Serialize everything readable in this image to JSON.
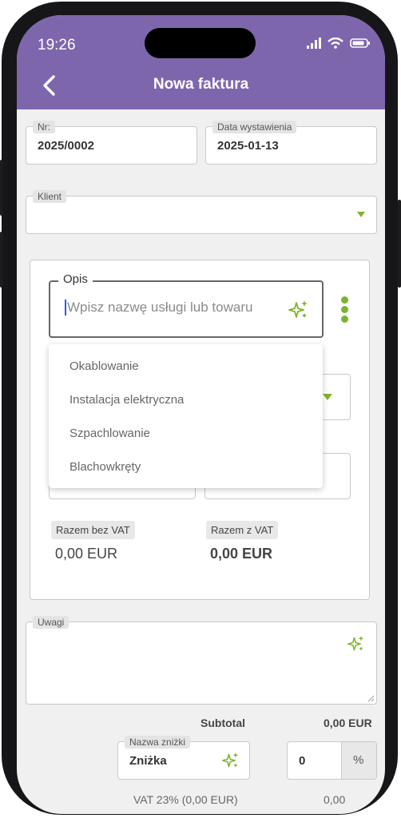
{
  "status": {
    "time": "19:26"
  },
  "header": {
    "title": "Nowa faktura"
  },
  "form": {
    "nr": {
      "label": "Nr:",
      "value": "2025/0002"
    },
    "date": {
      "label": "Data wystawienia",
      "value": "2025-01-13"
    },
    "client": {
      "label": "Klient",
      "value": ""
    }
  },
  "item": {
    "opis_label": "Opis",
    "opis_placeholder": "Wpisz nazwę usługi lub towaru",
    "suggestions": [
      "Okablowanie",
      "Instalacja elektryczna",
      "Szpachlowanie",
      "Blachowkręty"
    ],
    "net_label": "Razem bez VAT",
    "net_value": "0,00 EUR",
    "gross_label": "Razem z VAT",
    "gross_value": "0,00 EUR"
  },
  "notes": {
    "label": "Uwagi",
    "value": ""
  },
  "summary": {
    "subtotal_label": "Subtotal",
    "subtotal_value": "0,00 EUR",
    "discount_label": "Nazwa zniżki",
    "discount_name": "Zniżka",
    "discount_value": "0",
    "discount_unit": "%",
    "vat_label": "VAT 23% (0,00 EUR)",
    "vat_value": "0,00"
  },
  "colors": {
    "header": "#7e66ad",
    "accent": "#7cb32e"
  },
  "icons": {
    "back": "chevron-left-icon",
    "sparkle": "sparkle-icon",
    "menu": "kebab-menu-icon",
    "dropdown": "caret-down-icon"
  }
}
